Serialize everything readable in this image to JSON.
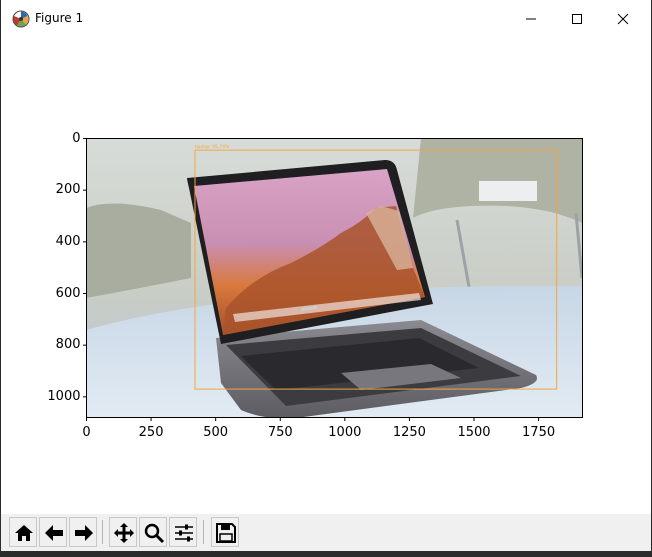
{
  "window": {
    "title": "Figure 1",
    "app_icon": "matplotlib-figure-icon",
    "controls": [
      "minimize-icon",
      "maximize-icon",
      "close-icon"
    ]
  },
  "plot": {
    "image_description_icon": "laptop-photo",
    "detection": {
      "label": "laptop: 95.74%",
      "box": {
        "x_min": 420,
        "y_min": 45,
        "x_max": 1820,
        "y_max": 970
      },
      "color": "#f4a640"
    },
    "xlim": [
      0,
      1920
    ],
    "ylim": [
      1080,
      0
    ],
    "x_ticks": [
      "0",
      "250",
      "500",
      "750",
      "1000",
      "1250",
      "1500",
      "1750"
    ],
    "x_tick_values": [
      0,
      250,
      500,
      750,
      1000,
      1250,
      1500,
      1750
    ],
    "y_ticks": [
      "0",
      "200",
      "400",
      "600",
      "800",
      "1000"
    ],
    "y_tick_values": [
      0,
      200,
      400,
      600,
      800,
      1000
    ]
  },
  "toolbar": {
    "buttons": [
      {
        "name": "home-button",
        "icon": "home-icon",
        "tooltip": "Reset original view"
      },
      {
        "name": "back-button",
        "icon": "arrow-left-icon",
        "tooltip": "Back"
      },
      {
        "name": "forward-button",
        "icon": "arrow-right-icon",
        "tooltip": "Forward"
      },
      {
        "name": "pan-button",
        "icon": "move-icon",
        "tooltip": "Pan"
      },
      {
        "name": "zoom-button",
        "icon": "magnifier-icon",
        "tooltip": "Zoom"
      },
      {
        "name": "configure-button",
        "icon": "sliders-icon",
        "tooltip": "Configure subplots"
      },
      {
        "name": "save-button",
        "icon": "floppy-disk-icon",
        "tooltip": "Save the figure"
      }
    ]
  }
}
